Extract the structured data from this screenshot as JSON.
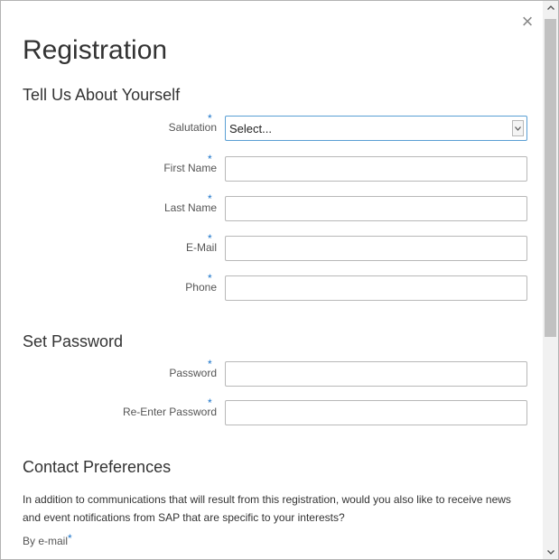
{
  "dialog": {
    "title": "Registration",
    "close_glyph": "×",
    "close_icon": "close-icon"
  },
  "about": {
    "heading": "Tell Us About Yourself",
    "fields": [
      {
        "label": "Salutation",
        "required": "*",
        "type": "select",
        "value": "Select..."
      },
      {
        "label": "First Name",
        "required": "*",
        "type": "text",
        "value": ""
      },
      {
        "label": "Last Name",
        "required": "*",
        "type": "text",
        "value": ""
      },
      {
        "label": "E-Mail",
        "required": "*",
        "type": "text",
        "value": ""
      },
      {
        "label": "Phone",
        "required": "*",
        "type": "text",
        "value": ""
      }
    ]
  },
  "password": {
    "heading": "Set Password",
    "fields": [
      {
        "label": "Password",
        "required": "*",
        "type": "password",
        "value": ""
      },
      {
        "label": "Re-Enter Password",
        "required": "*",
        "type": "password",
        "value": ""
      }
    ]
  },
  "contact": {
    "heading": "Contact Preferences",
    "text": "In addition to communications that will result from this registration, would you also like to receive news and event notifications from SAP that are specific to your interests?",
    "email_label": "By e-mail",
    "email_required": "*"
  },
  "colors": {
    "required_star": "#1a73c9",
    "select_focus_border": "#5a9fd4"
  }
}
